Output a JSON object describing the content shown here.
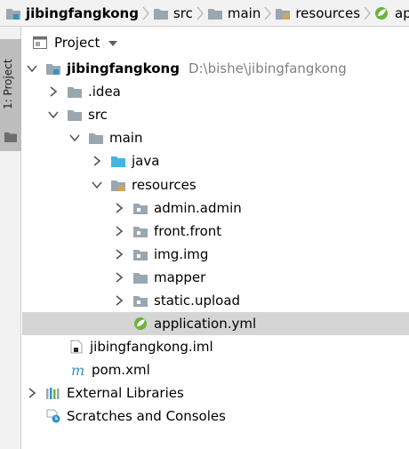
{
  "breadcrumb": [
    "jibingfangkong",
    "src",
    "main",
    "resources",
    "application.yml"
  ],
  "toolwindow": {
    "label": "1: Project"
  },
  "panel": {
    "title": "Project"
  },
  "tree": [
    {
      "label": "jibingfangkong",
      "hint": "D:\\bishe\\jibingfangkong"
    },
    {
      "label": ".idea"
    },
    {
      "label": "src"
    },
    {
      "label": "main"
    },
    {
      "label": "java"
    },
    {
      "label": "resources"
    },
    {
      "label": "admin.admin"
    },
    {
      "label": "front.front"
    },
    {
      "label": "img.img"
    },
    {
      "label": "mapper"
    },
    {
      "label": "static.upload"
    },
    {
      "label": "application.yml"
    },
    {
      "label": "jibingfangkong.iml"
    },
    {
      "label": "pom.xml"
    },
    {
      "label": "External Libraries"
    },
    {
      "label": "Scratches and Consoles"
    }
  ]
}
